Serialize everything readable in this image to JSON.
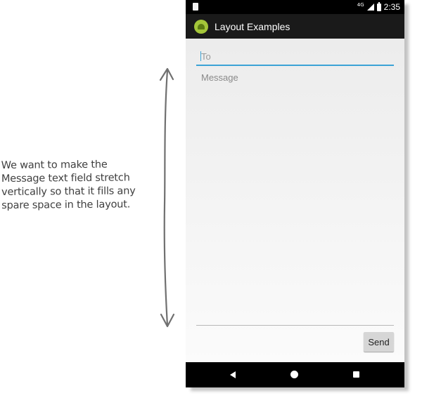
{
  "annotation": {
    "lines": [
      "We want to make the",
      "Message text field stretch",
      "vertically so that it fills any",
      "spare space in the layout."
    ]
  },
  "status_bar": {
    "network": "4G",
    "time": "2:35"
  },
  "app_bar": {
    "title": "Layout Examples"
  },
  "form": {
    "to_placeholder": "To",
    "message_placeholder": "Message",
    "send_label": "Send"
  },
  "colors": {
    "accent": "#3ba3d6",
    "app_bar": "#1a1a1a",
    "status_bar": "#000000",
    "button": "#d6d6d6"
  },
  "icons": [
    "notification-icon",
    "signal-icon",
    "battery-icon",
    "android-app-icon",
    "back-icon",
    "home-icon",
    "recents-icon"
  ]
}
